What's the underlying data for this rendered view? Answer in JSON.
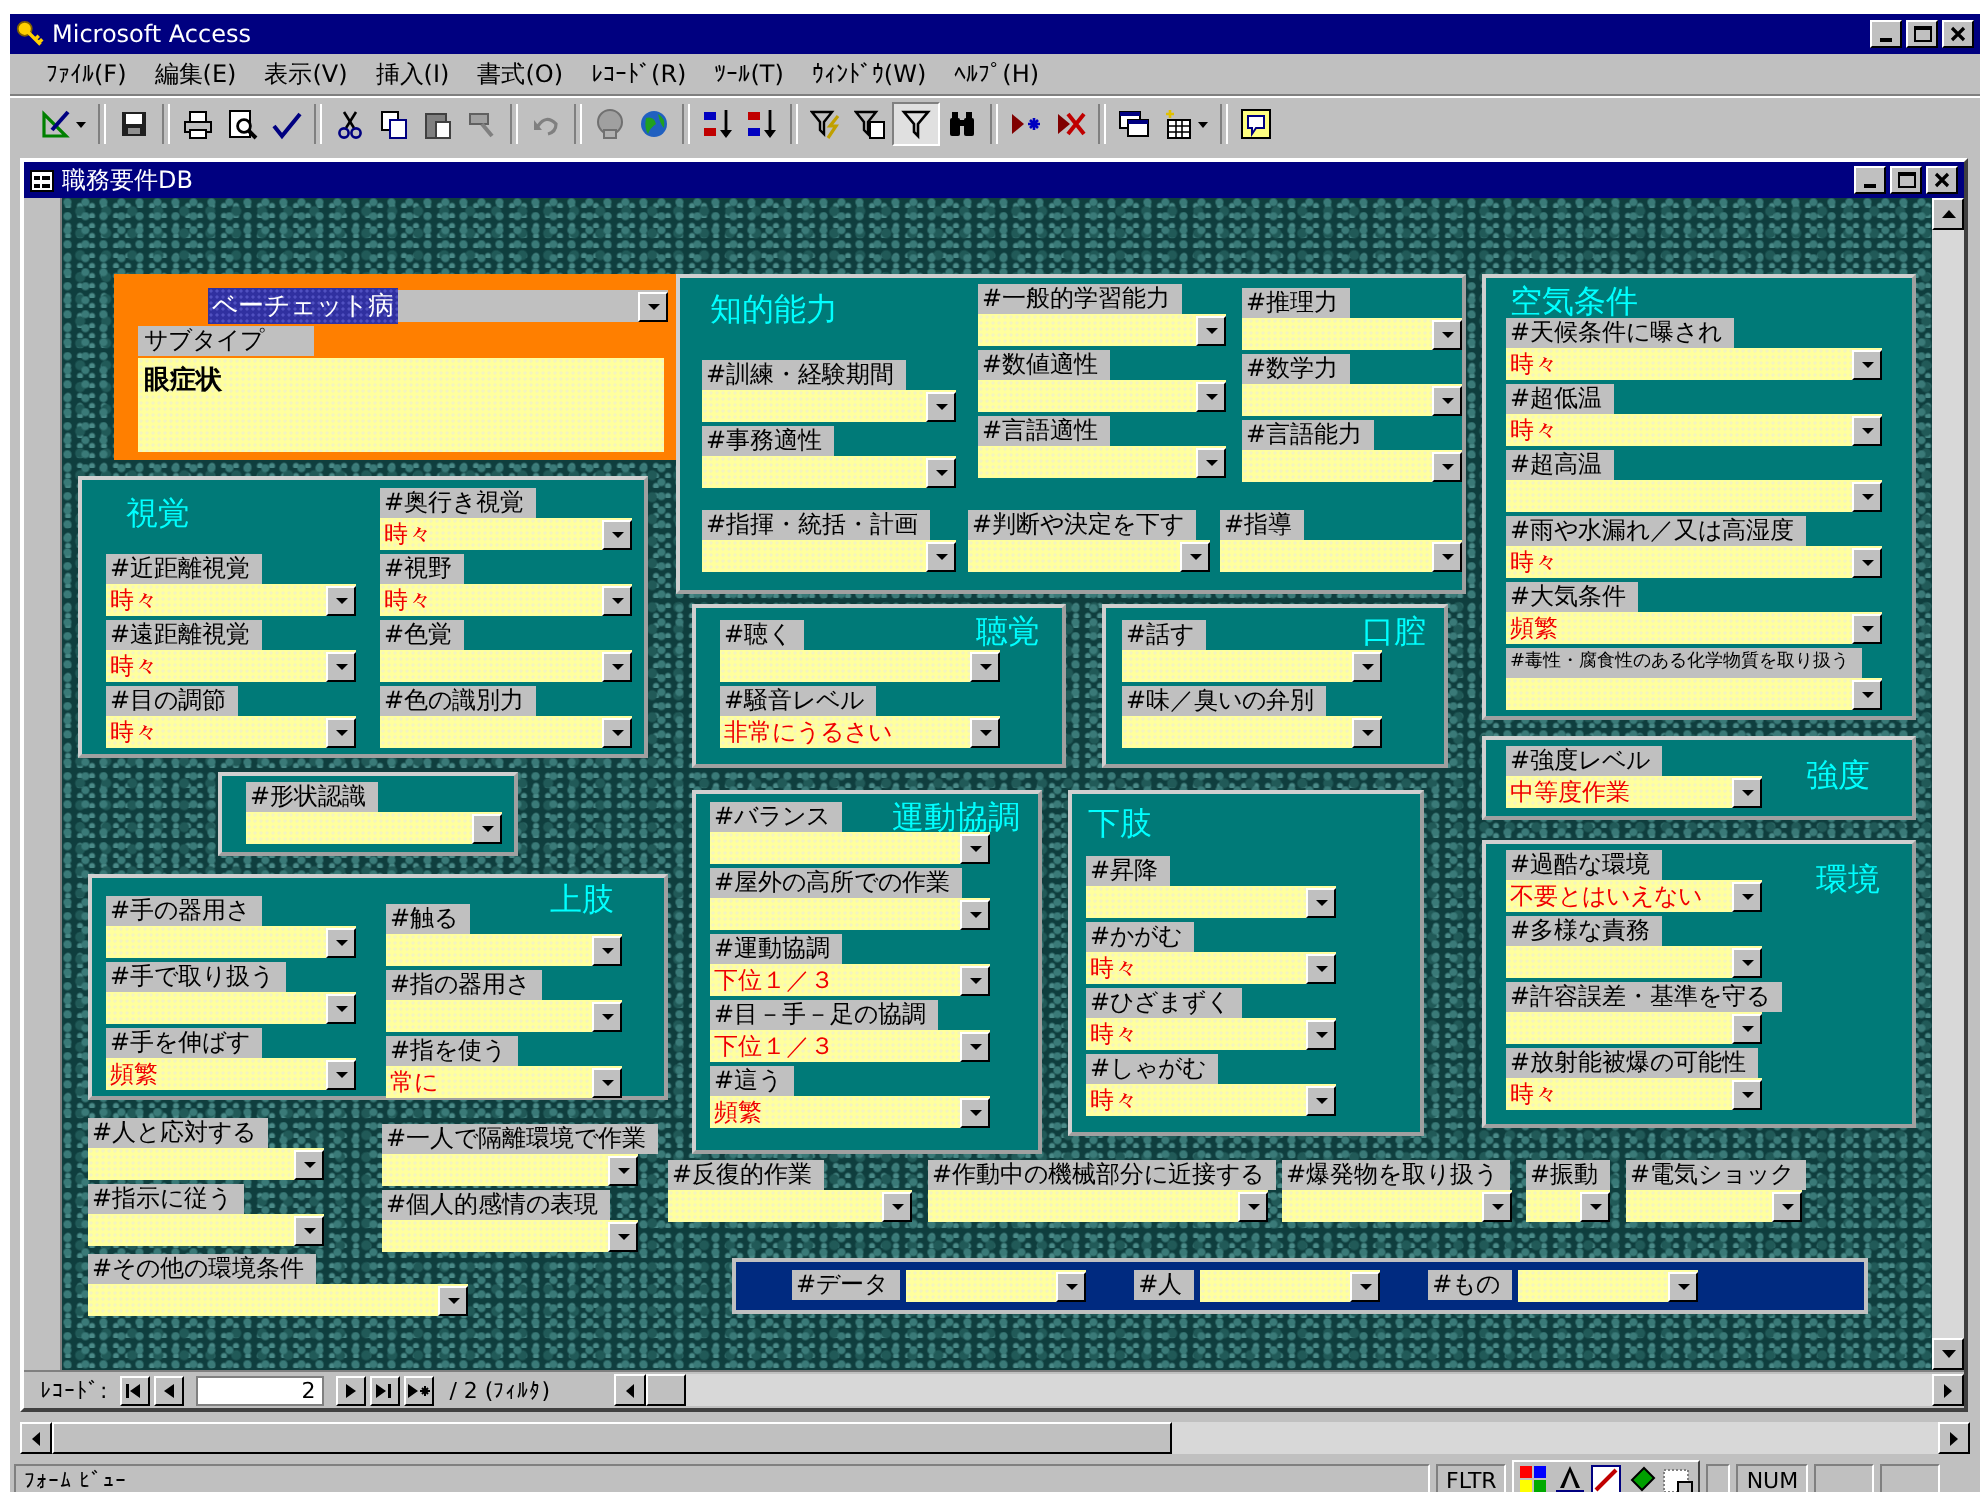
{
  "window": {
    "title": "Microsoft Access"
  },
  "menu": [
    "ﾌｧｲﾙ(F)",
    "編集(E)",
    "表示(V)",
    "挿入(I)",
    "書式(O)",
    "ﾚｺｰﾄﾞ(R)",
    "ﾂｰﾙ(T)",
    "ｳｨﾝﾄﾞｳ(W)",
    "ﾍﾙﾌﾟ(H)"
  ],
  "toolbar": {
    "filter_applied": true
  },
  "form_window": {
    "title": "職務要件DB"
  },
  "header": {
    "disease": "ベーチェット病",
    "disease_selected": true,
    "subtype_label": "サブタイプ",
    "subtype": "眼症状"
  },
  "panels": [
    {
      "kind": "group",
      "title": "視覚",
      "columns": [
        [
          {
            "label": "#近距離視覚",
            "value": "時々"
          },
          {
            "label": "#遠距離視覚",
            "value": "時々"
          },
          {
            "label": "#目の調節",
            "value": "時々"
          }
        ],
        [
          {
            "label": "#奥行き視覚",
            "value": "時々"
          },
          {
            "label": "#視野",
            "value": "時々"
          },
          {
            "label": "#色覚"
          },
          {
            "label": "#色の識別力"
          }
        ]
      ]
    },
    {
      "kind": "group",
      "title": "知的能力",
      "columns": [
        [
          {
            "label": "#訓練・経験期間"
          },
          {
            "label": "#事務適性"
          }
        ],
        [
          {
            "label": "#一般的学習能力"
          },
          {
            "label": "#数値適性"
          },
          {
            "label": "#言語適性"
          }
        ],
        [
          {
            "label": "#推理力"
          },
          {
            "label": "#数学力"
          },
          {
            "label": "#言語能力"
          }
        ],
        [
          {
            "label": "#指揮・統括・計画"
          }
        ],
        [
          {
            "label": "#判断や決定を下す"
          }
        ],
        [
          {
            "label": "#指導"
          }
        ]
      ]
    },
    {
      "kind": "group",
      "title": "空気条件",
      "columns": [
        [
          {
            "label": "#天候条件に曝され",
            "value": "時々"
          },
          {
            "label": "#超低温",
            "value": "時々"
          },
          {
            "label": "#超高温"
          },
          {
            "label": "#雨や水漏れ／又は高湿度",
            "value": "時々"
          },
          {
            "label": "#大気条件",
            "value": "頻繁"
          },
          {
            "label": "#毒性・腐食性のある化学物質を取り扱う"
          }
        ]
      ]
    },
    {
      "kind": "group",
      "title": "聴覚",
      "columns": [
        [
          {
            "label": "#聴く"
          },
          {
            "label": "#騒音レベル",
            "value": "非常にうるさい"
          }
        ]
      ]
    },
    {
      "kind": "group",
      "title": "口腔",
      "columns": [
        [
          {
            "label": "#話す"
          },
          {
            "label": "#味／臭いの弁別"
          }
        ]
      ]
    },
    {
      "kind": "group",
      "title": "強度",
      "columns": [
        [
          {
            "label": "#強度レベル",
            "value": "中等度作業"
          }
        ]
      ]
    },
    {
      "kind": "group",
      "title": "環境",
      "columns": [
        [
          {
            "label": "#過酷な環境",
            "value": "不要とはいえない"
          },
          {
            "label": "#多様な責務"
          },
          {
            "label": "#許容誤差・基準を守る"
          },
          {
            "label": "#放射能被爆の可能性",
            "value": "時々"
          }
        ]
      ]
    },
    {
      "kind": "group",
      "columns": [
        [
          {
            "label": "#形状認識"
          }
        ]
      ]
    },
    {
      "kind": "group",
      "title": "上肢",
      "columns": [
        [
          {
            "label": "#手の器用さ"
          },
          {
            "label": "#手で取り扱う"
          },
          {
            "label": "#手を伸ばす",
            "value": "頻繁"
          }
        ],
        [
          {
            "label": "#触る"
          },
          {
            "label": "#指の器用さ"
          },
          {
            "label": "#指を使う",
            "value": "常に"
          }
        ]
      ]
    },
    {
      "kind": "group",
      "title": "運動協調",
      "columns": [
        [
          {
            "label": "#バランス"
          },
          {
            "label": "#屋外の高所での作業"
          },
          {
            "label": "#運動協調",
            "value": "下位１／３"
          },
          {
            "label": "#目－手－足の協調",
            "value": "下位１／３"
          },
          {
            "label": "#這う",
            "value": "頻繁"
          }
        ]
      ]
    },
    {
      "kind": "group",
      "title": "下肢",
      "columns": [
        [
          {
            "label": "#昇降"
          },
          {
            "label": "#かがむ",
            "value": "時々"
          },
          {
            "label": "#ひざまずく",
            "value": "時々"
          },
          {
            "label": "#しゃがむ",
            "value": "時々"
          }
        ]
      ]
    },
    {
      "kind": "free",
      "columns": [
        [
          {
            "label": "#人と応対する"
          },
          {
            "label": "#指示に従う"
          }
        ],
        [
          {
            "label": "#その他の環境条件"
          }
        ],
        [
          {
            "label": "#一人で隔離環境で作業"
          },
          {
            "label": "#個人的感情の表現"
          }
        ],
        [
          {
            "label": "#反復的作業"
          }
        ],
        [
          {
            "label": "#作動中の機械部分に近接する"
          }
        ],
        [
          {
            "label": "#爆発物を取り扱う"
          }
        ],
        [
          {
            "label": "#振動"
          }
        ],
        [
          {
            "label": "#電気ショック"
          }
        ]
      ]
    },
    {
      "kind": "bar",
      "columns": [
        [
          {
            "label": "#データ"
          }
        ],
        [
          {
            "label": "#人"
          }
        ],
        [
          {
            "label": "#もの"
          }
        ]
      ]
    }
  ],
  "navigation": {
    "label": "ﾚｺｰﾄﾞ:",
    "record": "2",
    "total": "/ 2 (ﾌｨﾙﾀ)"
  },
  "status_bar": {
    "text": "ﾌｫｰﾑ ﾋﾞｭｰ",
    "indicators": [
      "FLTR",
      "NUM"
    ]
  }
}
